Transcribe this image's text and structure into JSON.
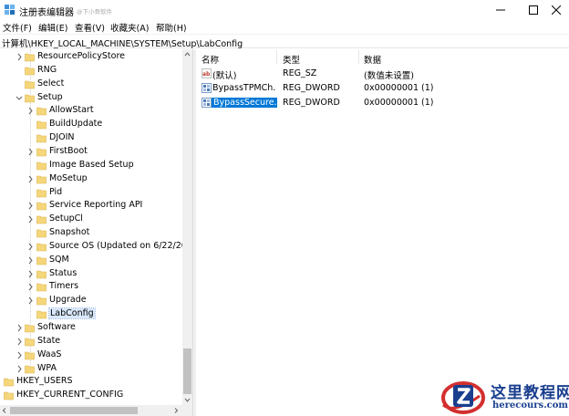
{
  "window": {
    "title": "注册表编辑器",
    "watermark": "@下小骨软件",
    "controls": {
      "minimize": "minimize-icon",
      "maximize": "maximize-icon",
      "close": "close-icon"
    }
  },
  "menu": [
    "文件(F)",
    "编辑(E)",
    "查看(V)",
    "收藏夹(A)",
    "帮助(H)"
  ],
  "address": "计算机\\HKEY_LOCAL_MACHINE\\SYSTEM\\Setup\\LabConfig",
  "tree": [
    {
      "label": "ResourcePolicyStore",
      "level": 1,
      "expander": "collapsed"
    },
    {
      "label": "RNG",
      "level": 1,
      "expander": "none"
    },
    {
      "label": "Select",
      "level": 1,
      "expander": "none"
    },
    {
      "label": "Setup",
      "level": 1,
      "expander": "expanded"
    },
    {
      "label": "AllowStart",
      "level": 2,
      "expander": "collapsed"
    },
    {
      "label": "BuildUpdate",
      "level": 2,
      "expander": "none"
    },
    {
      "label": "DJOIN",
      "level": 2,
      "expander": "none"
    },
    {
      "label": "FirstBoot",
      "level": 2,
      "expander": "collapsed"
    },
    {
      "label": "Image Based Setup",
      "level": 2,
      "expander": "none"
    },
    {
      "label": "MoSetup",
      "level": 2,
      "expander": "collapsed"
    },
    {
      "label": "Pid",
      "level": 2,
      "expander": "none"
    },
    {
      "label": "Service Reporting API",
      "level": 2,
      "expander": "collapsed"
    },
    {
      "label": "SetupCl",
      "level": 2,
      "expander": "collapsed"
    },
    {
      "label": "Snapshot",
      "level": 2,
      "expander": "none"
    },
    {
      "label": "Source OS (Updated on 6/22/202",
      "level": 2,
      "expander": "collapsed"
    },
    {
      "label": "SQM",
      "level": 2,
      "expander": "collapsed"
    },
    {
      "label": "Status",
      "level": 2,
      "expander": "collapsed"
    },
    {
      "label": "Timers",
      "level": 2,
      "expander": "collapsed"
    },
    {
      "label": "Upgrade",
      "level": 2,
      "expander": "collapsed"
    },
    {
      "label": "LabConfig",
      "level": 2,
      "expander": "none",
      "selected": true
    },
    {
      "label": "Software",
      "level": 1,
      "expander": "collapsed"
    },
    {
      "label": "State",
      "level": 1,
      "expander": "collapsed"
    },
    {
      "label": "WaaS",
      "level": 1,
      "expander": "collapsed"
    },
    {
      "label": "WPA",
      "level": 1,
      "expander": "collapsed"
    },
    {
      "label": "HKEY_USERS",
      "level": 0,
      "expander": "collapsed"
    },
    {
      "label": "HKEY_CURRENT_CONFIG",
      "level": 0,
      "expander": "collapsed"
    }
  ],
  "columns": {
    "name": "名称",
    "type": "类型",
    "data": "数据"
  },
  "values": [
    {
      "name": "(默认)",
      "type": "REG_SZ",
      "data": "(数值未设置)",
      "icon": "string-value-icon"
    },
    {
      "name": "BypassTPMCh...",
      "type": "REG_DWORD",
      "data": "0x00000001 (1)",
      "icon": "binary-value-icon"
    },
    {
      "name": "BypassSecure...",
      "type": "REG_DWORD",
      "data": "0x00000001 (1)",
      "icon": "binary-value-icon",
      "selected": true
    }
  ],
  "logo": {
    "name": "这里教程网",
    "url": "herecours.com"
  },
  "colors": {
    "selection": "#0078d7",
    "folder": "#f5d67b",
    "logo": "#1a3f8f",
    "logo_red": "#d32f2f"
  }
}
